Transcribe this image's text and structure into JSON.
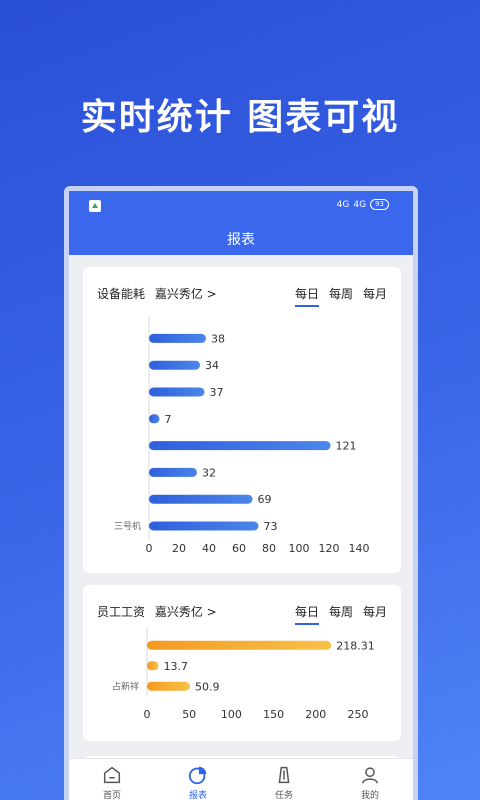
{
  "headline": "实时统计 图表可视",
  "status": {
    "sig1": "4G",
    "sig2": "4G",
    "battery": "93"
  },
  "appbar": {
    "title": "报表"
  },
  "card1": {
    "title": "设备能耗",
    "location": "嘉兴秀亿 >",
    "tabs": [
      "每日",
      "每周",
      "每月"
    ],
    "active_tab": 0
  },
  "card2": {
    "title": "员工工资",
    "location": "嘉兴秀亿 >",
    "tabs": [
      "每日",
      "每周",
      "每月"
    ],
    "active_tab": 0
  },
  "chart_data": [
    {
      "type": "bar",
      "orientation": "horizontal",
      "categories": [
        "",
        "",
        "",
        "",
        "",
        "",
        "",
        "三号机"
      ],
      "values": [
        38,
        34,
        37,
        7,
        121,
        32,
        69,
        73
      ],
      "xticks": [
        0,
        20,
        40,
        60,
        80,
        100,
        120,
        140
      ],
      "xlim": [
        0,
        140
      ],
      "colors": [
        "#4b86ea",
        "#2f5fdc"
      ]
    },
    {
      "type": "bar",
      "orientation": "horizontal",
      "categories": [
        "",
        "",
        "占新祥"
      ],
      "values": [
        218.31,
        13.7,
        50.9
      ],
      "xticks": [
        0,
        50,
        100,
        150,
        200,
        250
      ],
      "xlim": [
        0,
        250
      ],
      "colors": [
        "#f7c14a",
        "#f59a1e"
      ]
    }
  ],
  "tabbar": {
    "items": [
      {
        "label": "首页",
        "icon": "home-icon"
      },
      {
        "label": "报表",
        "icon": "chart-icon"
      },
      {
        "label": "任务",
        "icon": "task-icon"
      },
      {
        "label": "我的",
        "icon": "user-icon"
      }
    ],
    "active": 1
  }
}
